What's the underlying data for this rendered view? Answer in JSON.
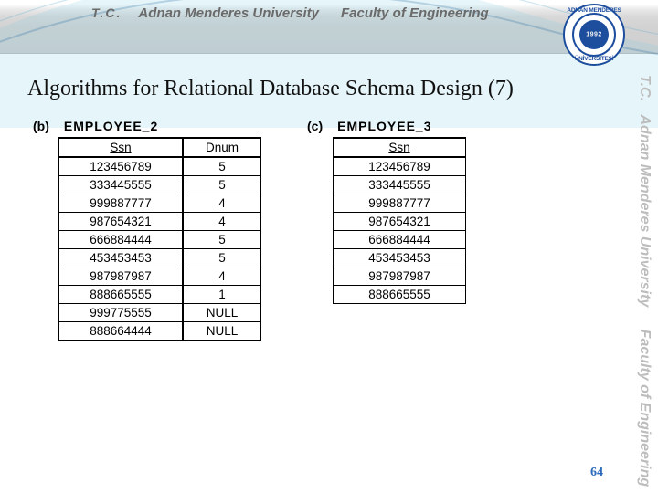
{
  "banner": {
    "tc": "T.C.",
    "university": "Adnan Menderes University",
    "faculty": "Faculty of Engineering",
    "logo_top": "ADNAN MENDERES",
    "logo_bottom": "ÜNİVERSİTESİ",
    "logo_year": "1992"
  },
  "vside": {
    "tc": "T.C.",
    "university": "Adnan Menderes University",
    "faculty": "Faculty of Engineering"
  },
  "title": "Algorithms for Relational Database Schema Design (7)",
  "figure_b": {
    "id": "(b)",
    "name": "EMPLOYEE_2",
    "columns": [
      "Ssn",
      "Dnum"
    ],
    "rows": [
      [
        "123456789",
        "5"
      ],
      [
        "333445555",
        "5"
      ],
      [
        "999887777",
        "4"
      ],
      [
        "987654321",
        "4"
      ],
      [
        "666884444",
        "5"
      ],
      [
        "453453453",
        "5"
      ],
      [
        "987987987",
        "4"
      ],
      [
        "888665555",
        "1"
      ],
      [
        "999775555",
        "NULL"
      ],
      [
        "888664444",
        "NULL"
      ]
    ]
  },
  "figure_c": {
    "id": "(c)",
    "name": "EMPLOYEE_3",
    "columns": [
      "Ssn"
    ],
    "rows": [
      [
        "123456789"
      ],
      [
        "333445555"
      ],
      [
        "999887777"
      ],
      [
        "987654321"
      ],
      [
        "666884444"
      ],
      [
        "453453453"
      ],
      [
        "987987987"
      ],
      [
        "888665555"
      ]
    ]
  },
  "page_number": "64"
}
